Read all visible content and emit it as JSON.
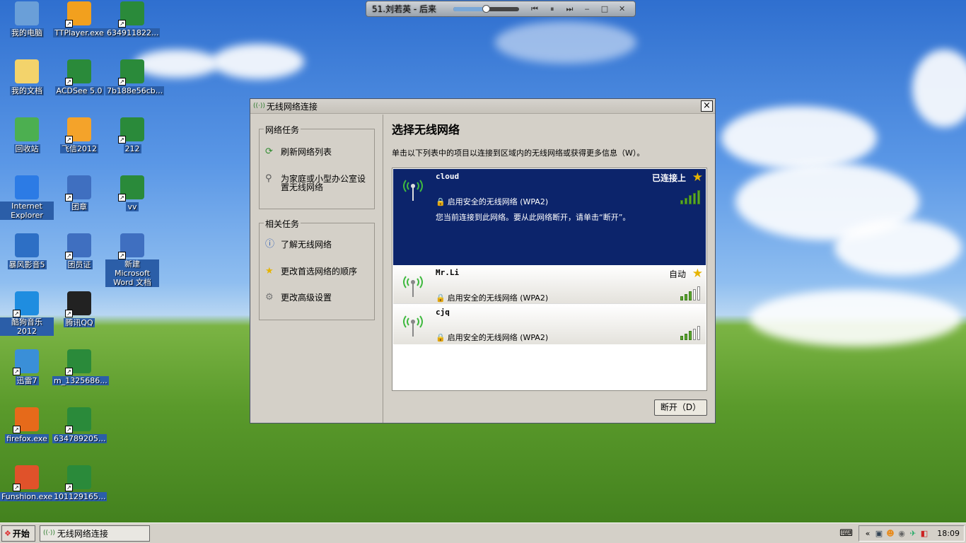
{
  "desktop_icons": [
    {
      "label": "我的电脑",
      "icon": "my-computer-icon",
      "color": "#6a9fd8"
    },
    {
      "label": "TTPlayer.exe",
      "icon": "ttplayer-icon",
      "color": "#f2a01e"
    },
    {
      "label": "634911822...",
      "icon": "image-file-icon",
      "color": "#2a8a3a"
    },
    {
      "label": "我的文档",
      "icon": "my-documents-icon",
      "color": "#f3d36b"
    },
    {
      "label": "ACDSee 5.0",
      "icon": "acdsee-icon",
      "color": "#2a8a3a"
    },
    {
      "label": "7b188e56cb...",
      "icon": "image-file-icon",
      "color": "#2a8a3a"
    },
    {
      "label": "回收站",
      "icon": "recycle-bin-icon",
      "color": "#4caf50"
    },
    {
      "label": "飞信2012",
      "icon": "fetion-icon",
      "color": "#f4a32a"
    },
    {
      "label": "212",
      "icon": "image-file-icon",
      "color": "#2a8a3a"
    },
    {
      "label": "Internet Explorer",
      "icon": "internet-explorer-icon",
      "color": "#2c7be5"
    },
    {
      "label": "团章",
      "icon": "word-doc-icon",
      "color": "#3f6fc0"
    },
    {
      "label": "vv",
      "icon": "image-file-icon",
      "color": "#2a8a3a"
    },
    {
      "label": "暴风影音5",
      "icon": "baofeng-icon",
      "color": "#2d6fc5"
    },
    {
      "label": "团员证",
      "icon": "word-doc-icon",
      "color": "#3f6fc0"
    },
    {
      "label": "新建 Microsoft Word 文档",
      "icon": "word-doc-icon",
      "color": "#3f6fc0"
    },
    {
      "label": "酷狗音乐 2012",
      "icon": "kugou-icon",
      "color": "#1f8de0"
    },
    {
      "label": "腾讯QQ",
      "icon": "qq-icon",
      "color": "#222222"
    },
    {
      "label": "迅雷7",
      "icon": "xunlei-icon",
      "color": "#3a8fd8"
    },
    {
      "label": "m_1325686...",
      "icon": "image-file-icon",
      "color": "#2a8a3a"
    },
    {
      "label": "firefox.exe",
      "icon": "firefox-icon",
      "color": "#e66a1a"
    },
    {
      "label": "634789205...",
      "icon": "image-file-icon",
      "color": "#2a8a3a"
    },
    {
      "label": "Funshion.exe",
      "icon": "funshion-icon",
      "color": "#e0522a"
    },
    {
      "label": "101129165...",
      "icon": "image-file-icon",
      "color": "#2a8a3a"
    }
  ],
  "player": {
    "title": "51.刘若英 - 后来",
    "progress": 0.5
  },
  "dialog": {
    "title": "无线网络连接",
    "network_tasks": {
      "title": "网络任务",
      "items": [
        {
          "label": "刷新网络列表",
          "icon": "refresh-icon"
        },
        {
          "label": "为家庭或小型办公室设置无线网络",
          "icon": "setup-network-icon"
        }
      ]
    },
    "related_tasks": {
      "title": "相关任务",
      "items": [
        {
          "label": "了解无线网络",
          "icon": "info-icon"
        },
        {
          "label": "更改首选网络的顺序",
          "icon": "star-icon"
        },
        {
          "label": "更改高级设置",
          "icon": "settings-icon"
        }
      ]
    },
    "heading": "选择无线网络",
    "instruction": "单击以下列表中的项目以连接到区域内的无线网络或获得更多信息（W）。",
    "networks": [
      {
        "name": "cloud",
        "status": "已连接上",
        "security": "启用安全的无线网络 (WPA2)",
        "detail": "您当前连接到此网络。要从此网络断开，请单击“断开”。",
        "signal": 5
      },
      {
        "name": "Mr.Li",
        "status": "自动",
        "security": "启用安全的无线网络 (WPA2)",
        "detail": "",
        "signal": 3
      },
      {
        "name": "cjq",
        "status": "",
        "security": "启用安全的无线网络 (WPA2)",
        "detail": "",
        "signal": 3
      }
    ],
    "disconnect_label": "断开（D）"
  },
  "taskbar": {
    "start_label": "开始",
    "window_label": "无线网络连接",
    "clock": "18:09"
  }
}
